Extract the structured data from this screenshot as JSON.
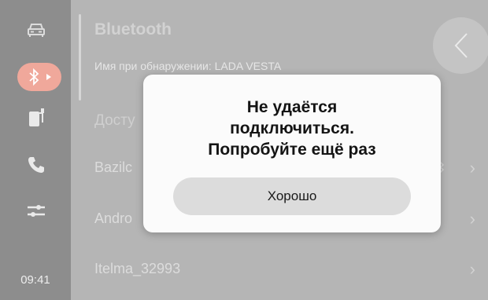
{
  "sidebar": {
    "items": [
      {
        "icon": "car-icon",
        "active": false
      },
      {
        "icon": "bluetooth-icon",
        "active": true
      },
      {
        "icon": "fuel-pump-icon",
        "active": false
      },
      {
        "icon": "phone-icon",
        "active": false
      },
      {
        "icon": "sliders-icon",
        "active": false
      }
    ],
    "clock": "09:41"
  },
  "header": {
    "title": "Bluetooth",
    "subtitle": "Имя при обнаружении: LADA VESTA",
    "back_icon": "chevron-left-icon"
  },
  "main": {
    "section_label": "Досту",
    "devices": [
      {
        "name": "Bazilc",
        "connected_icon": true
      },
      {
        "name": "Andro",
        "connected_icon": false
      },
      {
        "name": "Itelma_32993",
        "connected_icon": false
      }
    ]
  },
  "dialog": {
    "message_lines": [
      "Не удаётся",
      "подключиться.",
      "Попробуйте ещё раз"
    ],
    "ok_label": "Хорошо"
  },
  "colors": {
    "sidebar_bg": "#8d8d8d",
    "active_item": "#f0a89b",
    "overlay_bg": "#b5b5b5",
    "dialog_bg": "#fbfbfb",
    "button_bg": "#dcdcdc"
  }
}
